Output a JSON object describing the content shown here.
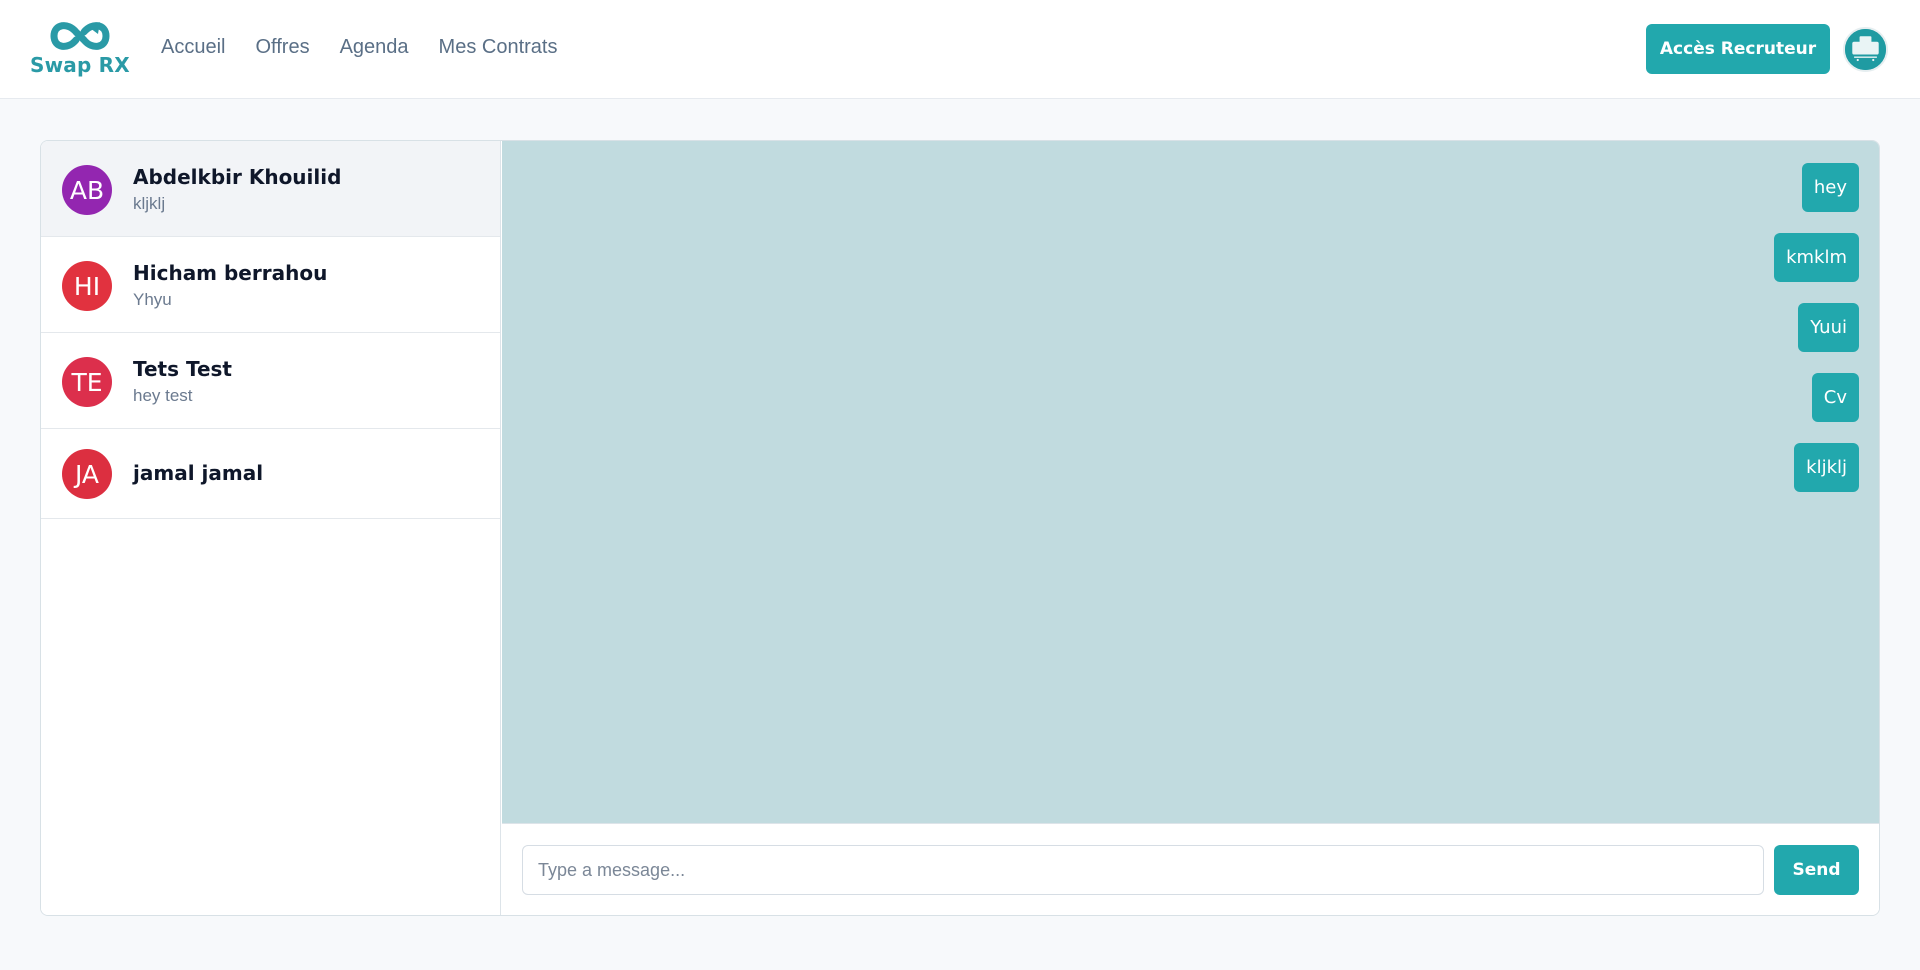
{
  "brand": {
    "name": "Swap RX",
    "color": "#2a9aa6",
    "logo_icon": "infinity-arrows-icon"
  },
  "nav": {
    "items": [
      {
        "label": "Accueil"
      },
      {
        "label": "Offres"
      },
      {
        "label": "Agenda"
      },
      {
        "label": "Mes Contrats"
      }
    ]
  },
  "header": {
    "recruiter_label": "Accès Recruteur",
    "profile_icon": "user-avatar-icon"
  },
  "contacts": [
    {
      "initials": "AB",
      "name": "Abdelkbir Khouilid",
      "preview": "kljklj",
      "color": "#9326b0",
      "active": true
    },
    {
      "initials": "HI",
      "name": "Hicham berrahou",
      "preview": "Yhyu",
      "color": "#e1323f",
      "active": false
    },
    {
      "initials": "TE",
      "name": "Tets Test",
      "preview": "hey test",
      "color": "#dc2f4c",
      "active": false
    },
    {
      "initials": "JA",
      "name": "jamal jamal",
      "preview": "",
      "color": "#dc2f40",
      "active": false
    }
  ],
  "messages": [
    {
      "text": "hey"
    },
    {
      "text": "kmklm"
    },
    {
      "text": "Yuui"
    },
    {
      "text": "Cv"
    },
    {
      "text": "kljklj"
    }
  ],
  "composer": {
    "placeholder": "Type a message...",
    "value": "",
    "send_label": "Send"
  },
  "colors": {
    "accent": "#22a8ad",
    "chat_background": "#c1dbdf"
  }
}
